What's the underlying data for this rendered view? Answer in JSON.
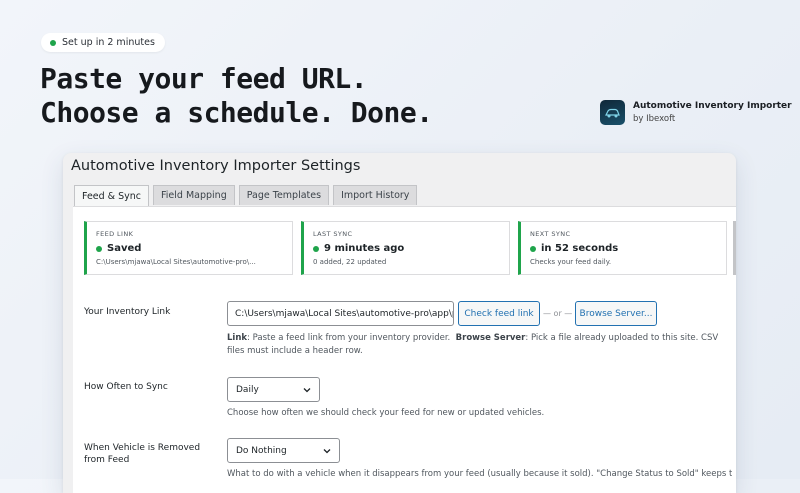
{
  "badge": {
    "text": "Set up in 2 minutes"
  },
  "headline": {
    "line1": "Paste your feed URL.",
    "line2": "Choose a schedule. Done."
  },
  "brand": {
    "name": "Automotive Inventory Importer",
    "by": "by Ibexoft"
  },
  "window": {
    "title": "Automotive Inventory Importer Settings",
    "tabs": [
      "Feed & Sync",
      "Field Mapping",
      "Page Templates",
      "Import History"
    ],
    "cards": [
      {
        "label": "FEED LINK",
        "value": "Saved",
        "sub": "C:\\Users\\mjawa\\Local Sites\\automotive-pro\\..."
      },
      {
        "label": "LAST SYNC",
        "value": "9 minutes ago",
        "sub": "0 added, 22 updated"
      },
      {
        "label": "NEXT SYNC",
        "value": "in 52 seconds",
        "sub": "Checks your feed daily."
      }
    ],
    "status_color": "#1fa44b",
    "inventory": {
      "label": "Your Inventory Link",
      "value": "C:\\Users\\mjawa\\Local Sites\\automotive-pro\\app\\public",
      "check_button": "Check feed link",
      "or_text": "— or —",
      "browse_button": "Browse Server...",
      "help_link_label": "Link",
      "help_link_text": ": Paste a feed link from your inventory provider.",
      "help_browse_label": "Browse Server",
      "help_browse_text": ": Pick a file already uploaded to this site. CSV files must include a header row."
    },
    "sync": {
      "label": "How Often to Sync",
      "selected": "Daily",
      "help": "Choose how often we should check your feed for new or updated vehicles."
    },
    "removed": {
      "label": "When Vehicle is Removed from Feed",
      "selected": "Do Nothing",
      "help": "What to do with a vehicle when it disappears from your feed (usually because it sold). \"Change Status to Sold\" keeps the page"
    }
  }
}
